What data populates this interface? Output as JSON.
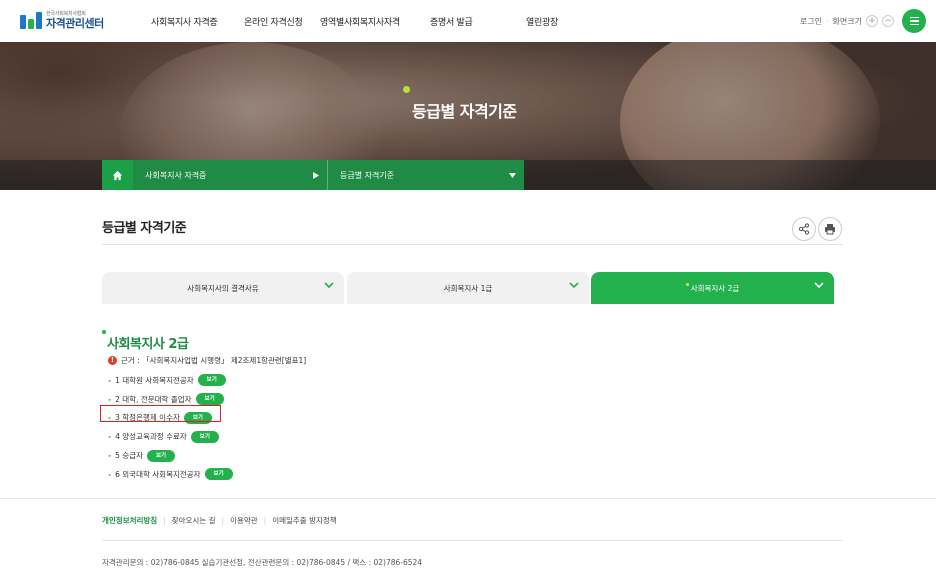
{
  "header": {
    "logo_sub": "한국사회복지사협회",
    "logo_main": "자격관리센터",
    "nav": [
      {
        "label": "사회복지사 자격증"
      },
      {
        "label": "온라인 자격신청"
      },
      {
        "label": "영역별사회복지사자격"
      },
      {
        "label": "증명서 발급"
      },
      {
        "label": "열린광장"
      }
    ],
    "login": "로그인",
    "zoom_label": "화면크기",
    "zoom_in": "+",
    "zoom_out": "−"
  },
  "hero": {
    "title": "등급별 자격기준"
  },
  "location": {
    "level1": "사회복지사 자격증",
    "level2": "등급별 자격기준"
  },
  "page": {
    "title": "등급별 자격기준"
  },
  "tabs": [
    {
      "label": "사회복지사의 결격사유",
      "active": false
    },
    {
      "label": "사회복지사 1급",
      "active": false
    },
    {
      "label": "사회복지사 2급",
      "active": true
    }
  ],
  "section": {
    "title": "사회복지사 2급",
    "basis": "근거 : 「사회복지사업법 시행령」 제2조제1항관련[별표1]",
    "view_label": "보기",
    "items": [
      {
        "label": "1 대학원 사회복지전공자"
      },
      {
        "label": "2 대학, 전문대학 졸업자"
      },
      {
        "label": "3 학점은행제 이수자"
      },
      {
        "label": "4 양성교육과정 수료자"
      },
      {
        "label": "5 승급자"
      },
      {
        "label": "6 외국대학 사회복지전공자"
      }
    ]
  },
  "footer": {
    "links": [
      {
        "label": "개인정보처리방침"
      },
      {
        "label": "찾아오시는 길"
      },
      {
        "label": "이용약관"
      },
      {
        "label": "이메일추출 방지정책"
      }
    ],
    "contact": "자격관리문의 : 02)786-0845     실습기관선정, 전산관련문의 : 02)786-0845   /   팩스 : 02)786-6524"
  },
  "colors": {
    "accent": "#23b14d",
    "accent_dark": "#1f8b45",
    "highlight": "#e02020"
  }
}
